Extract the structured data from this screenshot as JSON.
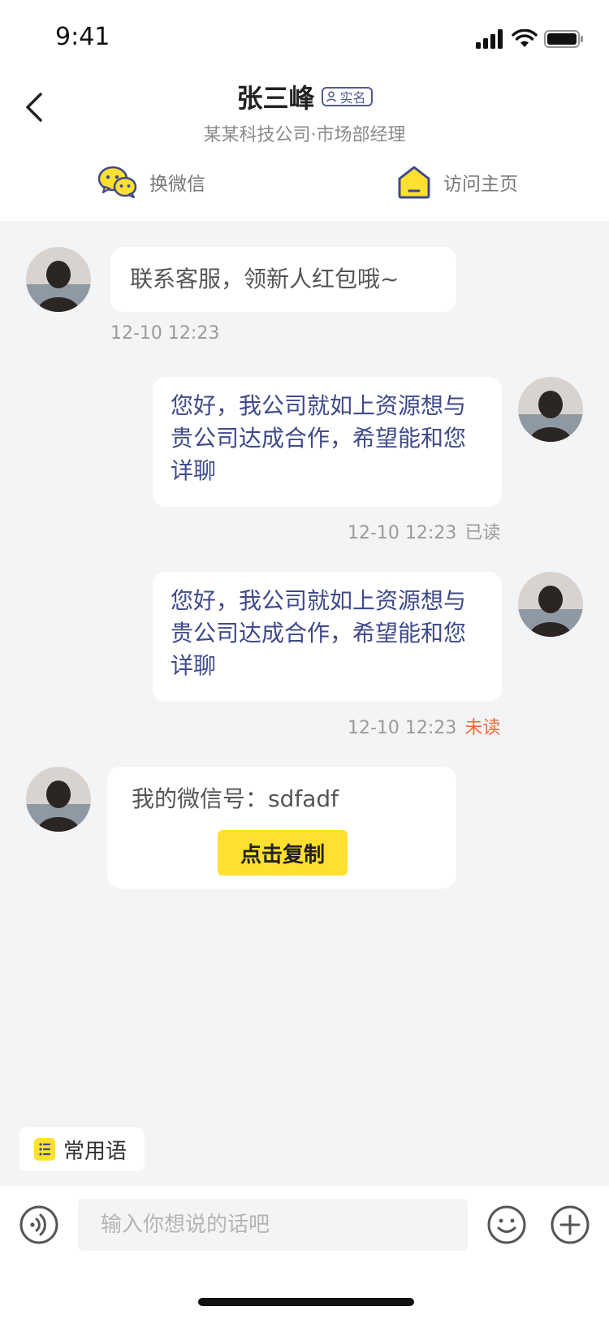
{
  "status_bar": {
    "time": "9:41"
  },
  "header": {
    "name": "张三峰",
    "badge_label": "实名",
    "subtitle": "某某科技公司·市场部经理",
    "actions": {
      "wechat_label": "换微信",
      "homepage_label": "访问主页"
    }
  },
  "messages": [
    {
      "direction": "in",
      "text": "联系客服，领新人红包哦~",
      "time": "12-10 12:23"
    },
    {
      "direction": "out",
      "text": "您好，我公司就如上资源想与贵公司达成合作，希望能和您详聊",
      "time": "12-10 12:23",
      "status": "已读"
    },
    {
      "direction": "out",
      "text": "您好，我公司就如上资源想与贵公司达成合作，希望能和您详聊",
      "time": "12-10 12:23",
      "status": "未读"
    },
    {
      "direction": "in",
      "text": "我的微信号：sdfadf",
      "button_label": "点击复制"
    }
  ],
  "quick_phrases": {
    "label": "常用语"
  },
  "composer": {
    "placeholder": "输入你想说的话吧"
  },
  "colors": {
    "accent_yellow": "#ffe02e",
    "brand_navy": "#3f4a8b",
    "unread_orange": "#f06a3a",
    "chat_background": "#f3f4f6"
  },
  "icons": {
    "back": "chevron-left-icon",
    "wechat": "wechat-icon",
    "home": "home-icon",
    "verified": "user-verified-icon",
    "voice": "voice-icon",
    "emoji": "emoji-icon",
    "plus": "plus-icon",
    "phrases": "list-icon"
  }
}
